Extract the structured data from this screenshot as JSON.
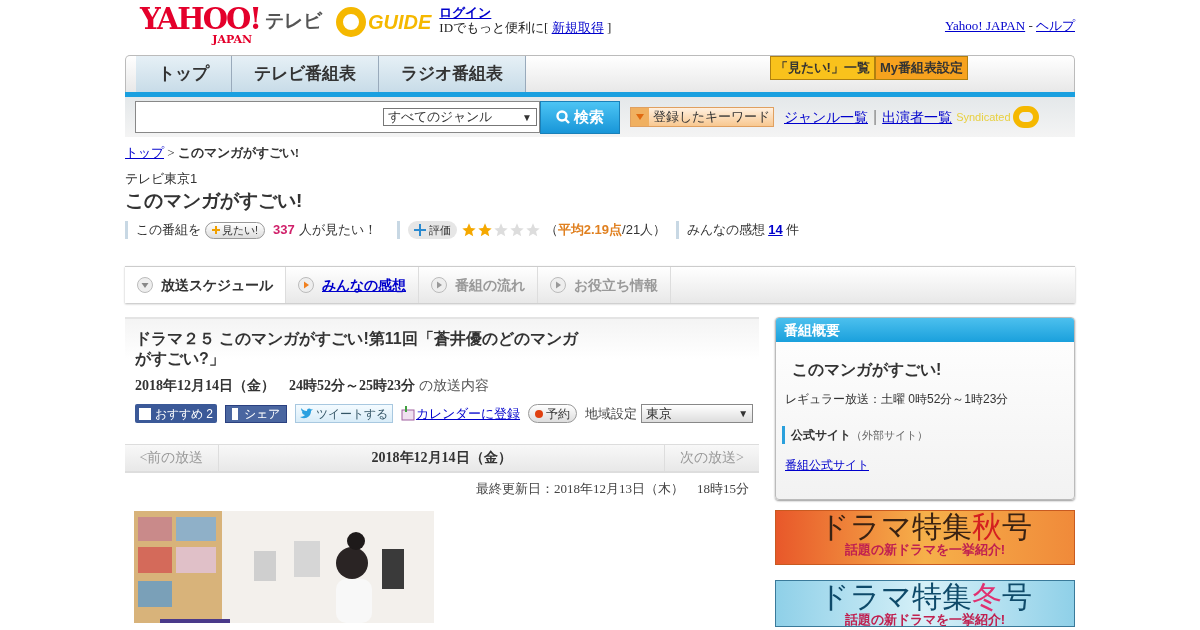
{
  "header": {
    "logo_text": "YAHOO!",
    "logo_sub": "JAPAN",
    "service": "テレビ",
    "gguide": "GUIDE",
    "login": "ログイン",
    "id_prefix": "IDでもっと便利に[",
    "signup": "新規取得",
    "id_suffix": "]",
    "yahoo_link": "Yahoo! JAPAN",
    "sep": "-",
    "help": "ヘルプ"
  },
  "nav": {
    "tabs": [
      {
        "label": "トップ"
      },
      {
        "label": "テレビ番組表"
      },
      {
        "label": "ラジオ番組表"
      }
    ],
    "right_buttons": [
      {
        "label": "「見たい!」一覧",
        "color": "#f9c21c"
      },
      {
        "label": "My番組表設定",
        "color": "#f7a21e"
      }
    ]
  },
  "search": {
    "genre": "すべてのジャンル",
    "caret": "▼",
    "button": "検索",
    "keyword_button": "登録したキーワード",
    "genre_list": "ジャンル一覧",
    "divider": "|",
    "cast_list": "出演者一覧",
    "syndicated": "Syndicated"
  },
  "breadcrumb": {
    "top": "トップ",
    "sep": ">",
    "current": "このマンガがすごい!"
  },
  "program": {
    "channel": "テレビ東京1",
    "title": "このマンガがすごい!",
    "want_prefix": "この番組を",
    "want_button": "見たい!",
    "want_count": "337",
    "want_suffix": "人が見たい！",
    "rate_button": "評価",
    "stars": 2,
    "avg_open": "（",
    "avg": "平均2.19点",
    "avg_rest": "/21人）",
    "impressions_label": "みんなの感想",
    "impressions_count": "14",
    "impressions_suffix": "件"
  },
  "tabs": [
    {
      "label": "放送スケジュール",
      "selected": true,
      "disabled": false
    },
    {
      "label": "みんなの感想",
      "selected": false,
      "disabled": false
    },
    {
      "label": "番組の流れ",
      "selected": false,
      "disabled": true
    },
    {
      "label": "お役立ち情報",
      "selected": false,
      "disabled": true
    }
  ],
  "episode": {
    "title": "ドラマ２５ このマンガがすごい!第11回「蒼井優のどのマンガがすごい?」",
    "airtime": "2018年12月14日（金）　24時52分～25時23分",
    "airtime_suffix": "の放送内容",
    "recommend": "おすすめ",
    "recommend_count": "2",
    "share": "シェア",
    "tweet": "ツイートする",
    "calendar": "カレンダーに登録",
    "reserve": "予約",
    "region_label": "地域設定",
    "region": "東京",
    "region_caret": "▼"
  },
  "pager": {
    "prev": "<前の放送",
    "current": "2018年12月14日（金）",
    "next": "次の放送>"
  },
  "updated": "最終更新日：2018年12月13日（木）　18時15分",
  "sidebar": {
    "header": "番組概要",
    "title": "このマンガがすごい!",
    "regular": "レギュラー放送：土曜 0時52分～1時23分",
    "official_label": "公式サイト",
    "official_note": "（外部サイト）",
    "official_link": "番組公式サイト"
  },
  "banners": [
    {
      "kind": "autumn",
      "title": "ドラマ特集",
      "accent": "秋",
      "title_end": "号",
      "subtitle": "話題の新ドラマを一挙紹介!"
    },
    {
      "kind": "winter",
      "title": "ドラマ特集",
      "accent": "冬",
      "title_end": "号",
      "subtitle": "話題の新ドラマを一挙紹介!"
    }
  ]
}
